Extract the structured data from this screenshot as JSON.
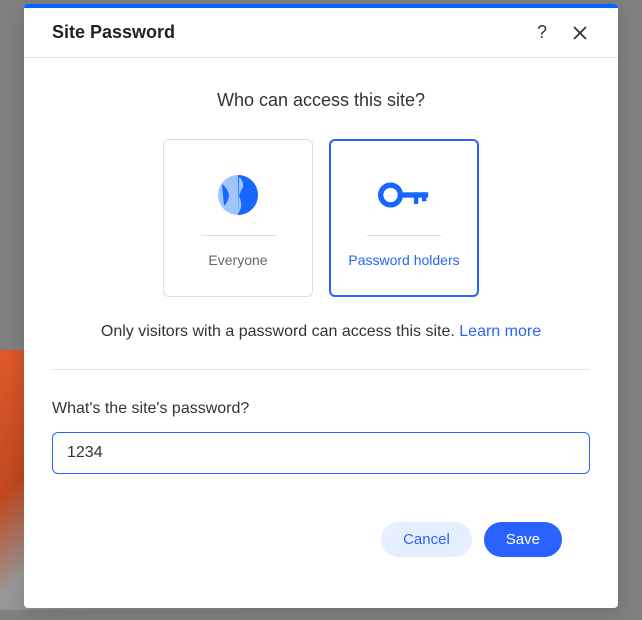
{
  "modal": {
    "title": "Site Password",
    "prompt": "Who can access this site?",
    "options": {
      "everyone": {
        "label": "Everyone"
      },
      "password_holders": {
        "label": "Password holders"
      }
    },
    "description_text": "Only visitors with a password can access this site. ",
    "learn_more": "Learn more",
    "password_label": "What's the site's password?",
    "password_value": "1234",
    "buttons": {
      "cancel": "Cancel",
      "save": "Save"
    }
  }
}
